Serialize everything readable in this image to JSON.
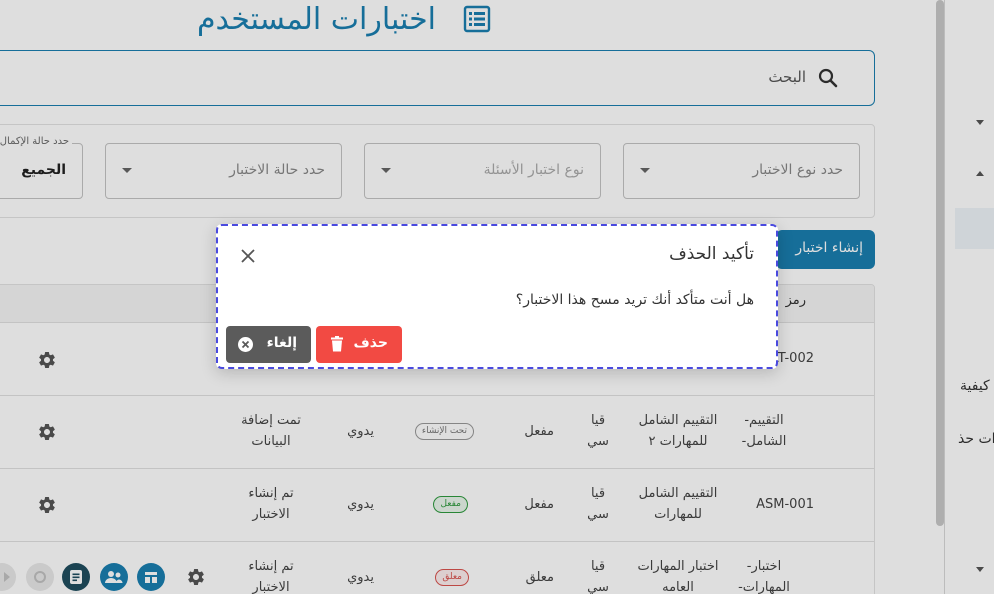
{
  "page": {
    "title": "اختبارات المستخدم",
    "search_label": "البحث",
    "create_button": "إنشاء اختبار"
  },
  "filters": {
    "type": "حدد نوع الاختبار",
    "question_type": "نوع اختبار الأسئلة",
    "status": "حدد حالة الاختبار",
    "completion_label": "حدد حالة الإكمال",
    "completion_value": "الجميع"
  },
  "table": {
    "partial_header": "رمز",
    "rows": [
      {
        "code": "GAT-002",
        "name": "",
        "company": "",
        "status": "",
        "badge": "",
        "method": "",
        "note": ""
      },
      {
        "code": "التقييم-الشامل-",
        "name": "التقييم الشامل للمهارات ٢",
        "company": "قيا سي",
        "status": "مفعل",
        "badge": "تحت الإنشاء",
        "method": "يدوي",
        "note": "تمت إضافة البيانات"
      },
      {
        "code": "ASM-001",
        "name": "التقييم الشامل للمهارات",
        "company": "قيا سي",
        "status": "مفعل",
        "badge": "مفعل",
        "method": "يدوي",
        "note": "تم إنشاء الاختبار"
      },
      {
        "code": "اختبار-المهارات-",
        "name": "اختبار المهارات العامه",
        "company": "قيا سي",
        "status": "معلق",
        "badge": "معلق",
        "method": "يدوي",
        "note": "تم إنشاء الاختبار"
      }
    ]
  },
  "sidebar": {
    "text1": "كيفية",
    "text2": "ات حذ"
  },
  "modal": {
    "title": "تأكيد الحذف",
    "message": "هل أنت متأكد أنك تريد مسح هذا الاختبار؟",
    "delete_label": "حذف",
    "cancel_label": "إلغاء"
  },
  "colors": {
    "primary": "#1a7fb0",
    "danger": "#f24a43",
    "neutral": "#5b5b5b",
    "success": "#2e9a3e"
  }
}
